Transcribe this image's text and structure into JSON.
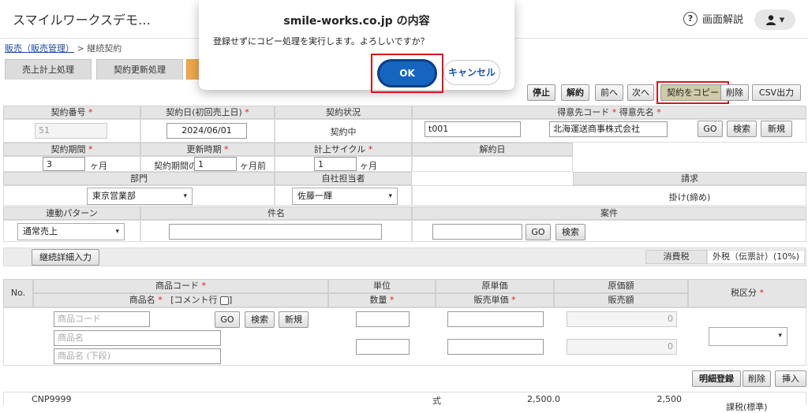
{
  "app": {
    "title": "スマイルワークスデモ…",
    "help_label": "画面解説",
    "user_caret": "▾"
  },
  "breadcrumb": {
    "link": "販売（販売管理）",
    "sep": ">",
    "current": "継続契約"
  },
  "tabs": [
    "売上計上処理",
    "契約更新処理",
    ""
  ],
  "toolbar": {
    "stop": "停止",
    "cancel": "解約",
    "prev": "前へ",
    "next": "次へ",
    "copy": "契約をコピー",
    "delete": "削除",
    "csv": "CSV出力"
  },
  "header_form": {
    "contract_no_label": "契約番号",
    "contract_no": "51",
    "contract_date_label": "契約日(初回売上日)",
    "contract_date": "2024/06/01",
    "status_label": "契約状況",
    "status": "契約中",
    "customer_label_code": "得意先コード",
    "customer_label_name": "得意先名",
    "customer_code": "t001",
    "customer_name": "北海運送商事株式会社",
    "go": "GO",
    "search": "検索",
    "new": "新規",
    "period_label": "契約期間",
    "period_value": "3",
    "period_unit": "ヶ月",
    "renew_label": "更新時期",
    "renew_prefix": "契約期間の",
    "renew_value": "1",
    "renew_unit": "ヶ月前",
    "cycle_label": "計上サイクル",
    "cycle_value": "1",
    "cycle_unit": "ヶ月",
    "cancel_date_label": "解約日",
    "dept_label": "部門",
    "dept_value": "東京営業部",
    "staff_label": "自社担当者",
    "staff_value": "佐藤一輝",
    "billing_label": "請求",
    "billing_value": "掛け(締め)",
    "pattern_label": "連動パターン",
    "pattern_value": "通常売上",
    "subject_label": "件名",
    "project_label": "案件",
    "project_go": "GO",
    "project_search": "検索"
  },
  "detail_bar": {
    "detail_button": "継続詳細入力",
    "tax_label": "消費税",
    "tax_value": "外税（伝票計）(10%)"
  },
  "lines": {
    "h_no": "No.",
    "h_code": "商品コード",
    "h_name": "商品名",
    "h_comment": "[コメント行",
    "h_unit": "単位",
    "h_qty": "数量",
    "h_cost": "原単価",
    "h_price": "販売単価",
    "h_costamt": "原価額",
    "h_sales": "販売額",
    "h_tax": "税区分",
    "ph_code": "商品コード",
    "ph_name": "商品名",
    "ph_name2": "商品名 (下段)",
    "go": "GO",
    "search": "検索",
    "new": "新規",
    "zero1": "0",
    "zero2": "0",
    "register": "明細登録",
    "delete": "削除",
    "insert": "挿入",
    "row1_code": "CNP9999",
    "row1_unit": "式",
    "row1_cost": "2,500.0",
    "row1_costamt": "2,500",
    "row1_tax": "課税(標準)"
  },
  "dialog": {
    "title": "smile-works.co.jp の内容",
    "message": "登録せずにコピー処理を実行します。よろしいですか？",
    "ok": "OK",
    "cancel": "キャンセル"
  },
  "colors": {
    "accent": "#1565c0",
    "highlight_frame": "#d9161c",
    "active_tab": "#f0a94a"
  }
}
